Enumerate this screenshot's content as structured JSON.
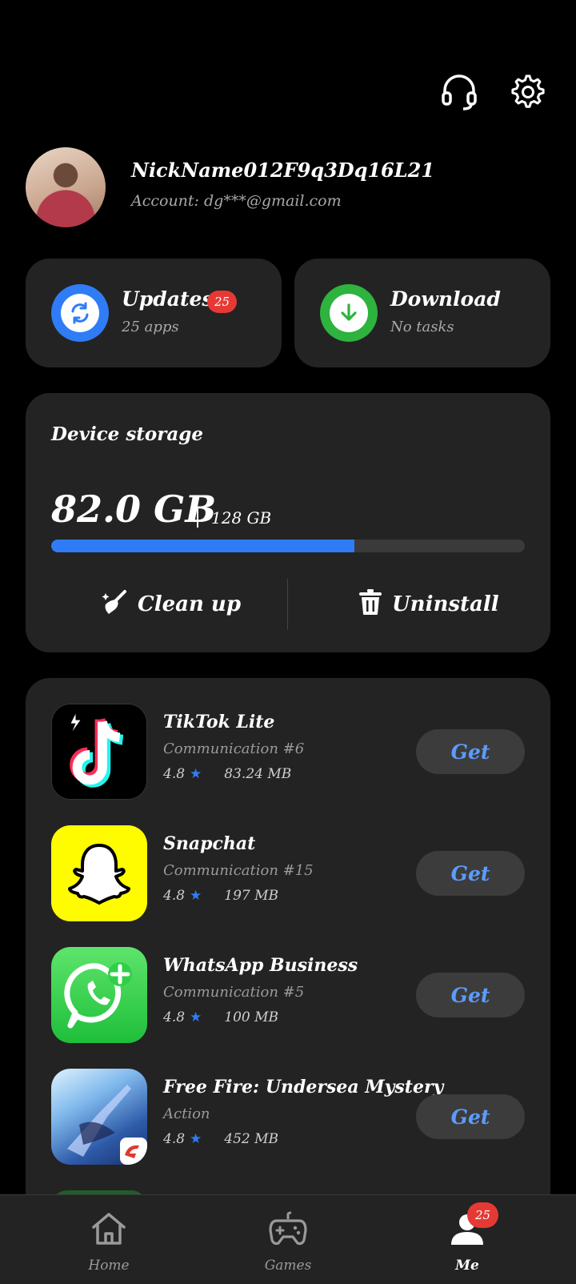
{
  "header": {
    "support_icon": "headset-icon",
    "settings_icon": "gear-icon"
  },
  "profile": {
    "nickname": "NickName012F9q3Dq16L21",
    "account": "Account: dg***@gmail.com"
  },
  "updates": {
    "title": "Updates",
    "badge": "25",
    "subtitle": "25 apps",
    "icon": "refresh-icon",
    "color": "#2f7cf6"
  },
  "download": {
    "title": "Download",
    "subtitle": "No tasks",
    "icon": "download-arrow-icon",
    "color": "#2db33e"
  },
  "storage": {
    "title": "Device storage",
    "used": "82.0 GB",
    "total": "128 GB",
    "used_fraction": 0.64,
    "clean_label": "Clean up",
    "uninstall_label": "Uninstall",
    "bar_color": "#2f7cf6"
  },
  "apps": [
    {
      "name": "TikTok Lite",
      "category": "Communication #6",
      "rating": "4.8",
      "size": "83.24 MB",
      "button": "Get",
      "icon": "tiktok-icon"
    },
    {
      "name": "Snapchat",
      "category": "Communication #15",
      "rating": "4.8",
      "size": "197 MB",
      "button": "Get",
      "icon": "snapchat-ghost-icon"
    },
    {
      "name": "WhatsApp Business",
      "category": "Communication #5",
      "rating": "4.8",
      "size": "100 MB",
      "button": "Get",
      "icon": "whatsapp-icon"
    },
    {
      "name": "Free Fire: Undersea Mystery",
      "category": "Action",
      "rating": "4.8",
      "size": "452 MB",
      "button": "Get",
      "icon": "free-fire-icon"
    }
  ],
  "nav": {
    "home": "Home",
    "games": "Games",
    "me": "Me",
    "me_badge": "25"
  }
}
